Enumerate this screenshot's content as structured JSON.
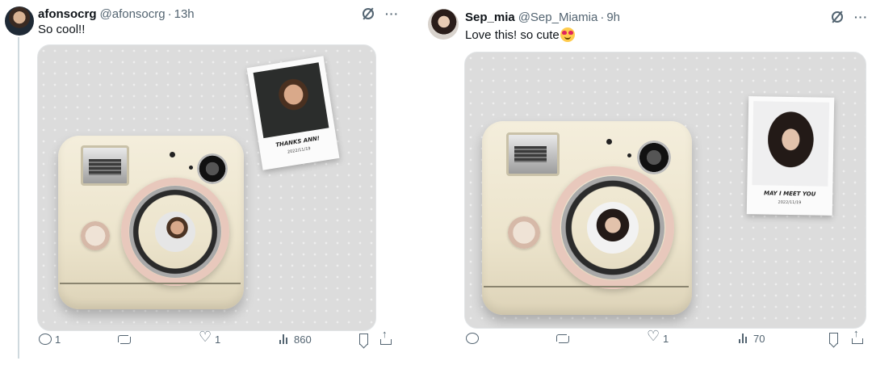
{
  "tweets": [
    {
      "author_name": "afonsocrg",
      "handle": "@afonsocrg",
      "separator": "·",
      "time": "13h",
      "text": "So cool!!",
      "polaroid_caption": "THANKS ANN!",
      "polaroid_date": "2022/11/19",
      "actions": {
        "replies": "1",
        "retweets": "",
        "likes": "1",
        "views": "860"
      }
    },
    {
      "author_name": "Sep_mia",
      "handle": "@Sep_Miamia",
      "separator": "·",
      "time": "9h",
      "text": "Love this! so cute",
      "emoji": "heart-eyes-emoji",
      "polaroid_caption": "MAY I MEET YOU",
      "polaroid_date": "2022/11/19",
      "actions": {
        "replies": "",
        "retweets": "",
        "likes": "1",
        "views": "70"
      }
    }
  ],
  "more_symbol": "···",
  "icons": [
    "grok-icon",
    "more-icon",
    "reply-icon",
    "retweet-icon",
    "like-icon",
    "views-icon",
    "bookmark-icon",
    "share-icon"
  ],
  "colors": {
    "text": "#0f1419",
    "secondary": "#536471",
    "thread_line": "#cfd9de",
    "camera_body": "#efe7d1",
    "lens_ring": "#e8c8bc"
  }
}
